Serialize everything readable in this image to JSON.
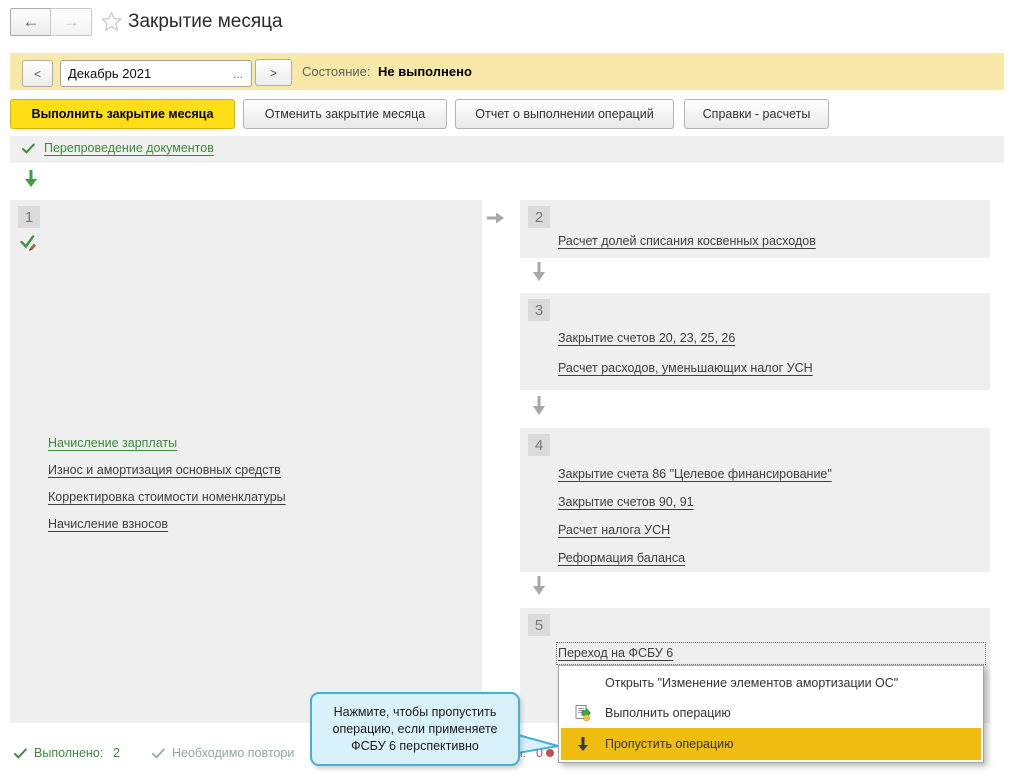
{
  "window": {
    "title": "Закрытие месяца"
  },
  "header": {
    "back_glyph": "←",
    "forward_glyph": "→"
  },
  "period_bar": {
    "prev_label": "<",
    "period_value": "Декабрь 2021",
    "choose_label": "...",
    "next_label": ">",
    "state_label": "Состояние:",
    "state_value": "Не выполнено"
  },
  "toolbar": {
    "buttons": [
      {
        "label": "Выполнить закрытие месяца"
      },
      {
        "label": "Отменить закрытие месяца"
      },
      {
        "label": "Отчет о выполнении операций"
      },
      {
        "label": "Справки - расчеты"
      }
    ]
  },
  "reposting": {
    "label": "Перепроведение документов"
  },
  "groups": [
    {
      "number": "1",
      "items": [
        {
          "label": "Начисление зарплаты",
          "status": "done"
        },
        {
          "label": "Износ и амортизация основных средств"
        },
        {
          "label": "Корректировка стоимости номенклатуры"
        },
        {
          "label": "Начисление взносов"
        }
      ]
    },
    {
      "number": "2",
      "items": [
        {
          "label": "Расчет долей списания косвенных расходов"
        }
      ]
    },
    {
      "number": "3",
      "items": [
        {
          "label": "Закрытие счетов 20, 23, 25, 26"
        },
        {
          "label": "Расчет расходов, уменьшающих налог УСН"
        }
      ]
    },
    {
      "number": "4",
      "items": [
        {
          "label": "Закрытие счета 86 \"Целевое финансирование\""
        },
        {
          "label": "Закрытие счетов 90, 91"
        },
        {
          "label": "Расчет налога УСН"
        },
        {
          "label": "Реформация баланса"
        }
      ]
    },
    {
      "number": "5",
      "items": [
        {
          "label": "Переход на ФСБУ 6",
          "focused": true
        }
      ]
    }
  ],
  "context_menu": {
    "items": [
      {
        "label": "Открыть \"Изменение элементов амортизации ОС\"",
        "icon": "none",
        "highlighted": false
      },
      {
        "label": "Выполнить операцию",
        "icon": "execute-operation-icon",
        "highlighted": false
      },
      {
        "label": "Пропустить операцию",
        "icon": "skip-operation-icon",
        "highlighted": true
      }
    ]
  },
  "tooltip": {
    "line1": "Нажмите, чтобы пропустить",
    "line2": "операцию, если применяете",
    "line3": "ФСБУ 6 перспективно"
  },
  "status_bar": {
    "done_label": "Выполнено:",
    "done_value": "2",
    "repeat_fragment": "Необходимо повтори",
    "errors_fragment": "ми:",
    "errors_value": "0"
  },
  "colors": {
    "accent_yellow": "#FFDE17",
    "bar_yellow": "#F9E9A9",
    "menu_highlight": "#F1BD11",
    "green": "#3B8A3B",
    "muted_teal": "#8CA9A2",
    "red": "#BF4B4B",
    "tooltip_bg": "#D8F1FA",
    "tooltip_border": "#45AFD4",
    "panel_gray": "#EFEFEF"
  }
}
